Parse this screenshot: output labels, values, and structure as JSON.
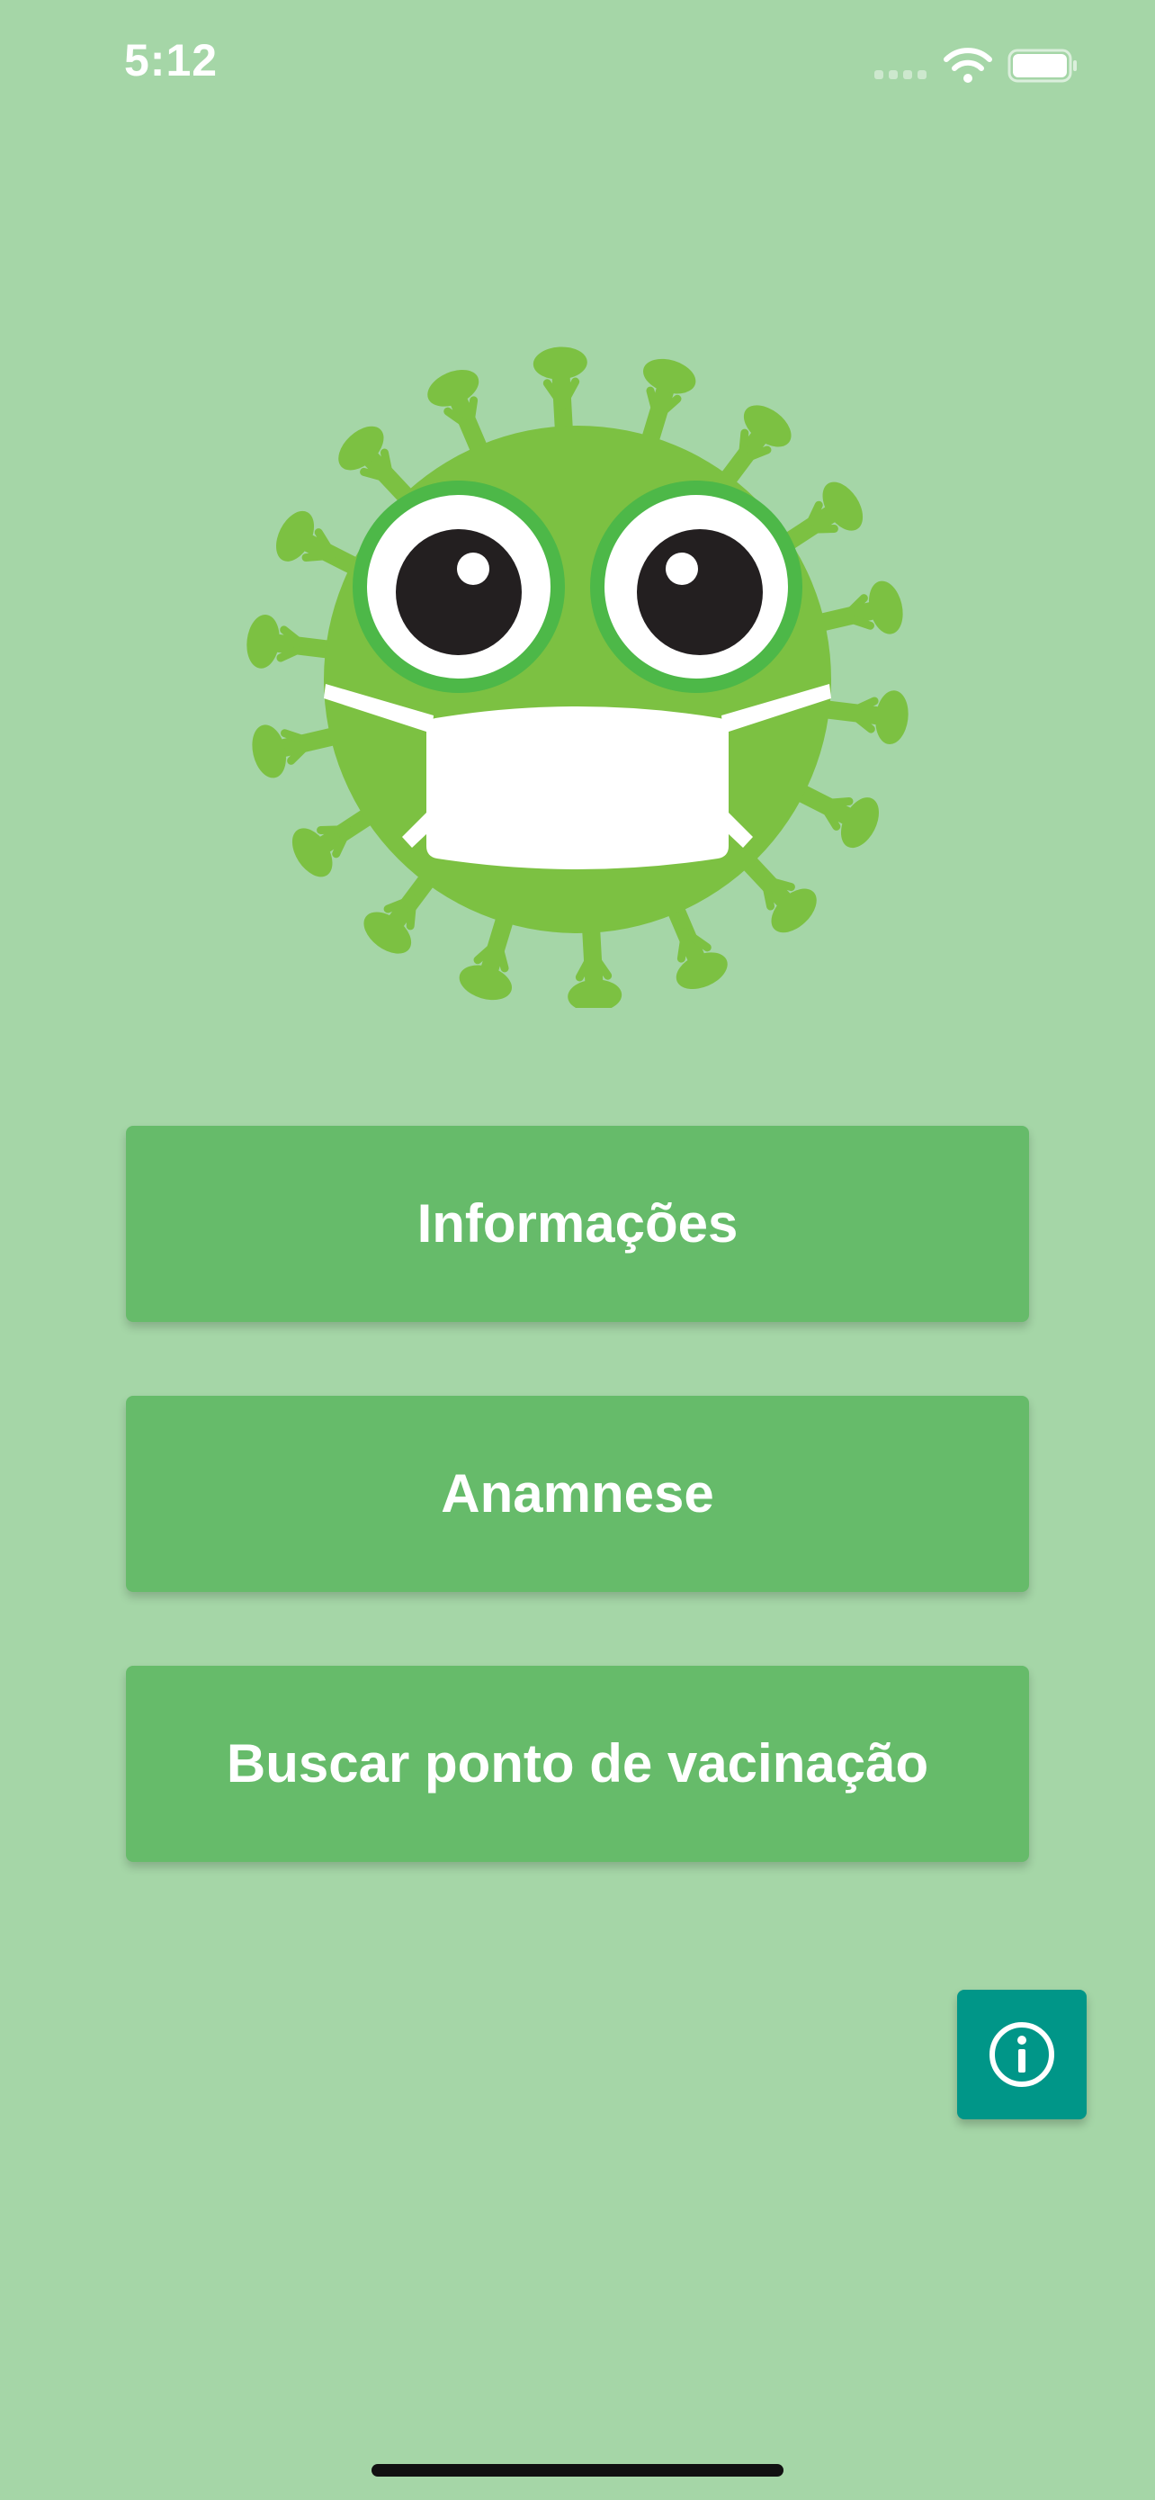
{
  "status_bar": {
    "time": "5:12",
    "icons": [
      "signal-icon",
      "wifi-icon",
      "battery-icon"
    ]
  },
  "logo": {
    "icon": "virus-mask-icon"
  },
  "menu": {
    "buttons": [
      {
        "label": "Informações"
      },
      {
        "label": "Anamnese"
      },
      {
        "label": "Buscar ponto de vacinação"
      }
    ]
  },
  "fab": {
    "icon": "info-icon"
  },
  "colors": {
    "background": "#a5d6a7",
    "button": "#66bb6a",
    "fab": "#009688",
    "virus_body": "#7cc142",
    "eye_ring": "#4db848"
  }
}
